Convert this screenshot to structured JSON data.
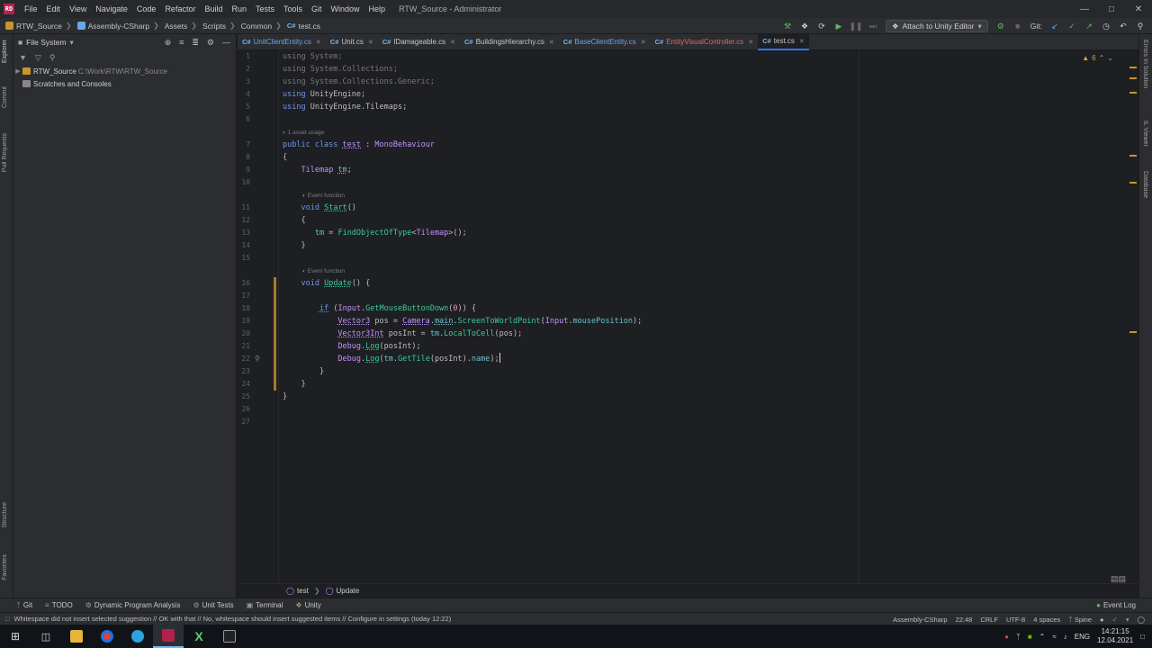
{
  "app": {
    "logo": "RD",
    "menu": [
      "File",
      "Edit",
      "View",
      "Navigate",
      "Code",
      "Refactor",
      "Build",
      "Run",
      "Tests",
      "Tools",
      "Git",
      "Window",
      "Help"
    ],
    "window_title": "RTW_Source - Administrator"
  },
  "navbar": {
    "breadcrumbs": [
      "RTW_Source",
      "Assembly-CSharp",
      "Assets",
      "Scripts",
      "Common",
      "test.cs"
    ],
    "attach_label": "Attach to Unity Editor",
    "git_label": "Git:"
  },
  "left_strip": [
    "Explorer",
    "Commit",
    "Pull Requests",
    "Structure",
    "Favorites"
  ],
  "right_strip": [
    "Errors In Solution",
    "IL Viewer",
    "Database"
  ],
  "explorer": {
    "title": "File System",
    "root_name": "RTW_Source",
    "root_path": "C:\\Work\\RTW\\RTW_Source",
    "scratches": "Scratches and Consoles"
  },
  "tabs": [
    {
      "name": "UnitClientEntity.cs",
      "style": "blue",
      "prefix": "C#"
    },
    {
      "name": "Unit.cs",
      "style": "",
      "prefix": "C#"
    },
    {
      "name": "IDamageable.cs",
      "style": "",
      "prefix": "C#"
    },
    {
      "name": "BuildingsHierarchy.cs",
      "style": "",
      "prefix": "C#"
    },
    {
      "name": "BaseClientEntity.cs",
      "style": "blue",
      "prefix": "C#"
    },
    {
      "name": "EntityVisualController.cs",
      "style": "red",
      "prefix": "C#"
    },
    {
      "name": "test.cs",
      "style": "active",
      "prefix": "C#"
    }
  ],
  "editor": {
    "warning_count": "6",
    "hints": {
      "asset_usage": "1 asset usage",
      "event_function": "Event function"
    },
    "lines": [
      "1",
      "2",
      "3",
      "4",
      "5",
      "6",
      "7",
      "8",
      "9",
      "10",
      "11",
      "12",
      "13",
      "14",
      "15",
      "16",
      "17",
      "18",
      "19",
      "20",
      "21",
      "22",
      "23",
      "24",
      "25",
      "26",
      "27"
    ]
  },
  "code_breadcrumb": {
    "class": "test",
    "method": "Update"
  },
  "tool_windows": [
    "Git",
    "TODO",
    "Dynamic Program Analysis",
    "Unit Tests",
    "Terminal",
    "Unity"
  ],
  "event_log": "Event Log",
  "status": {
    "message": "Whitespace did not insert selected suggestion // OK with that // No, whitespace should insert suggested items // Configure in settings (today 12:22)",
    "project": "Assembly-CSharp",
    "position": "22:48",
    "line_sep": "CRLF",
    "encoding": "UTF-8",
    "indent": "4 spaces",
    "spine": "Spine"
  },
  "taskbar": {
    "lang": "ENG",
    "time": "14:21:15",
    "date": "12.04.2021"
  }
}
